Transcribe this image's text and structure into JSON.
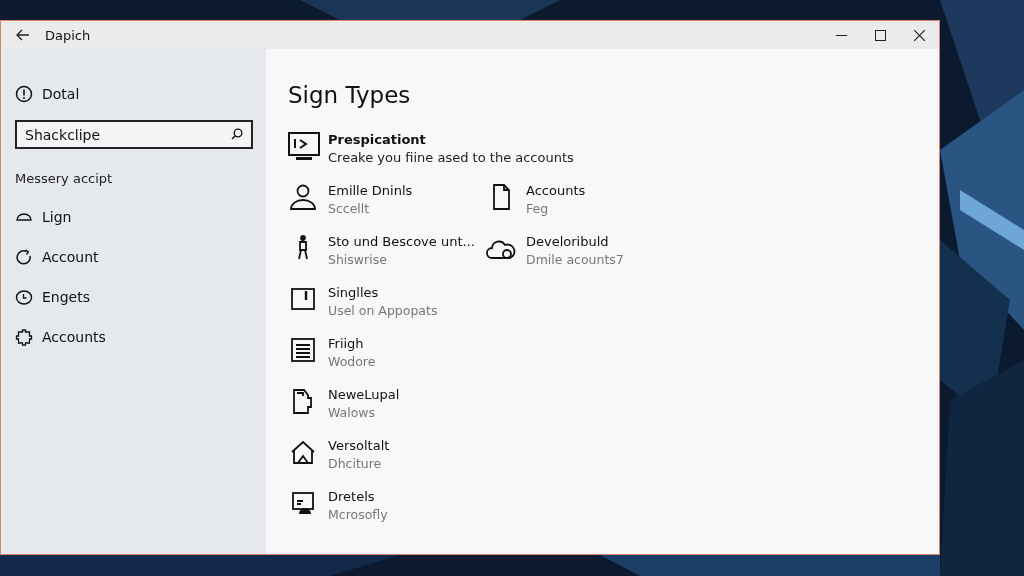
{
  "window": {
    "title": "Dapich"
  },
  "sidebar": {
    "header": "Dotal",
    "search": {
      "value": "Shackclipe"
    },
    "section_label": "Messery accipt",
    "items": [
      {
        "label": "Lign"
      },
      {
        "label": "Account"
      },
      {
        "label": "Engets"
      },
      {
        "label": "Accounts"
      }
    ]
  },
  "content": {
    "heading": "Sign Types",
    "featured": {
      "title": "Prespicationt",
      "description": "Creake you fiine ased to the accounts"
    },
    "rows": [
      [
        {
          "title": "Emille Dninls",
          "subtitle": "Sccellt"
        },
        {
          "title": "Accounts",
          "subtitle": "Feg"
        }
      ],
      [
        {
          "title": "Sto und Bescove unt...",
          "subtitle": "Shiswrise"
        },
        {
          "title": "Develoribuld",
          "subtitle": "Dmile acounts7"
        }
      ],
      [
        {
          "title": "Singlles",
          "subtitle": "Usel on Appopats"
        }
      ],
      [
        {
          "title": "Friigh",
          "subtitle": "Wodore"
        }
      ],
      [
        {
          "title": "NeweLupal",
          "subtitle": "Walows"
        }
      ],
      [
        {
          "title": "Versoltalt",
          "subtitle": "Dhciture"
        }
      ],
      [
        {
          "title": "Dretels",
          "subtitle": "Mcrosofly"
        }
      ]
    ]
  }
}
